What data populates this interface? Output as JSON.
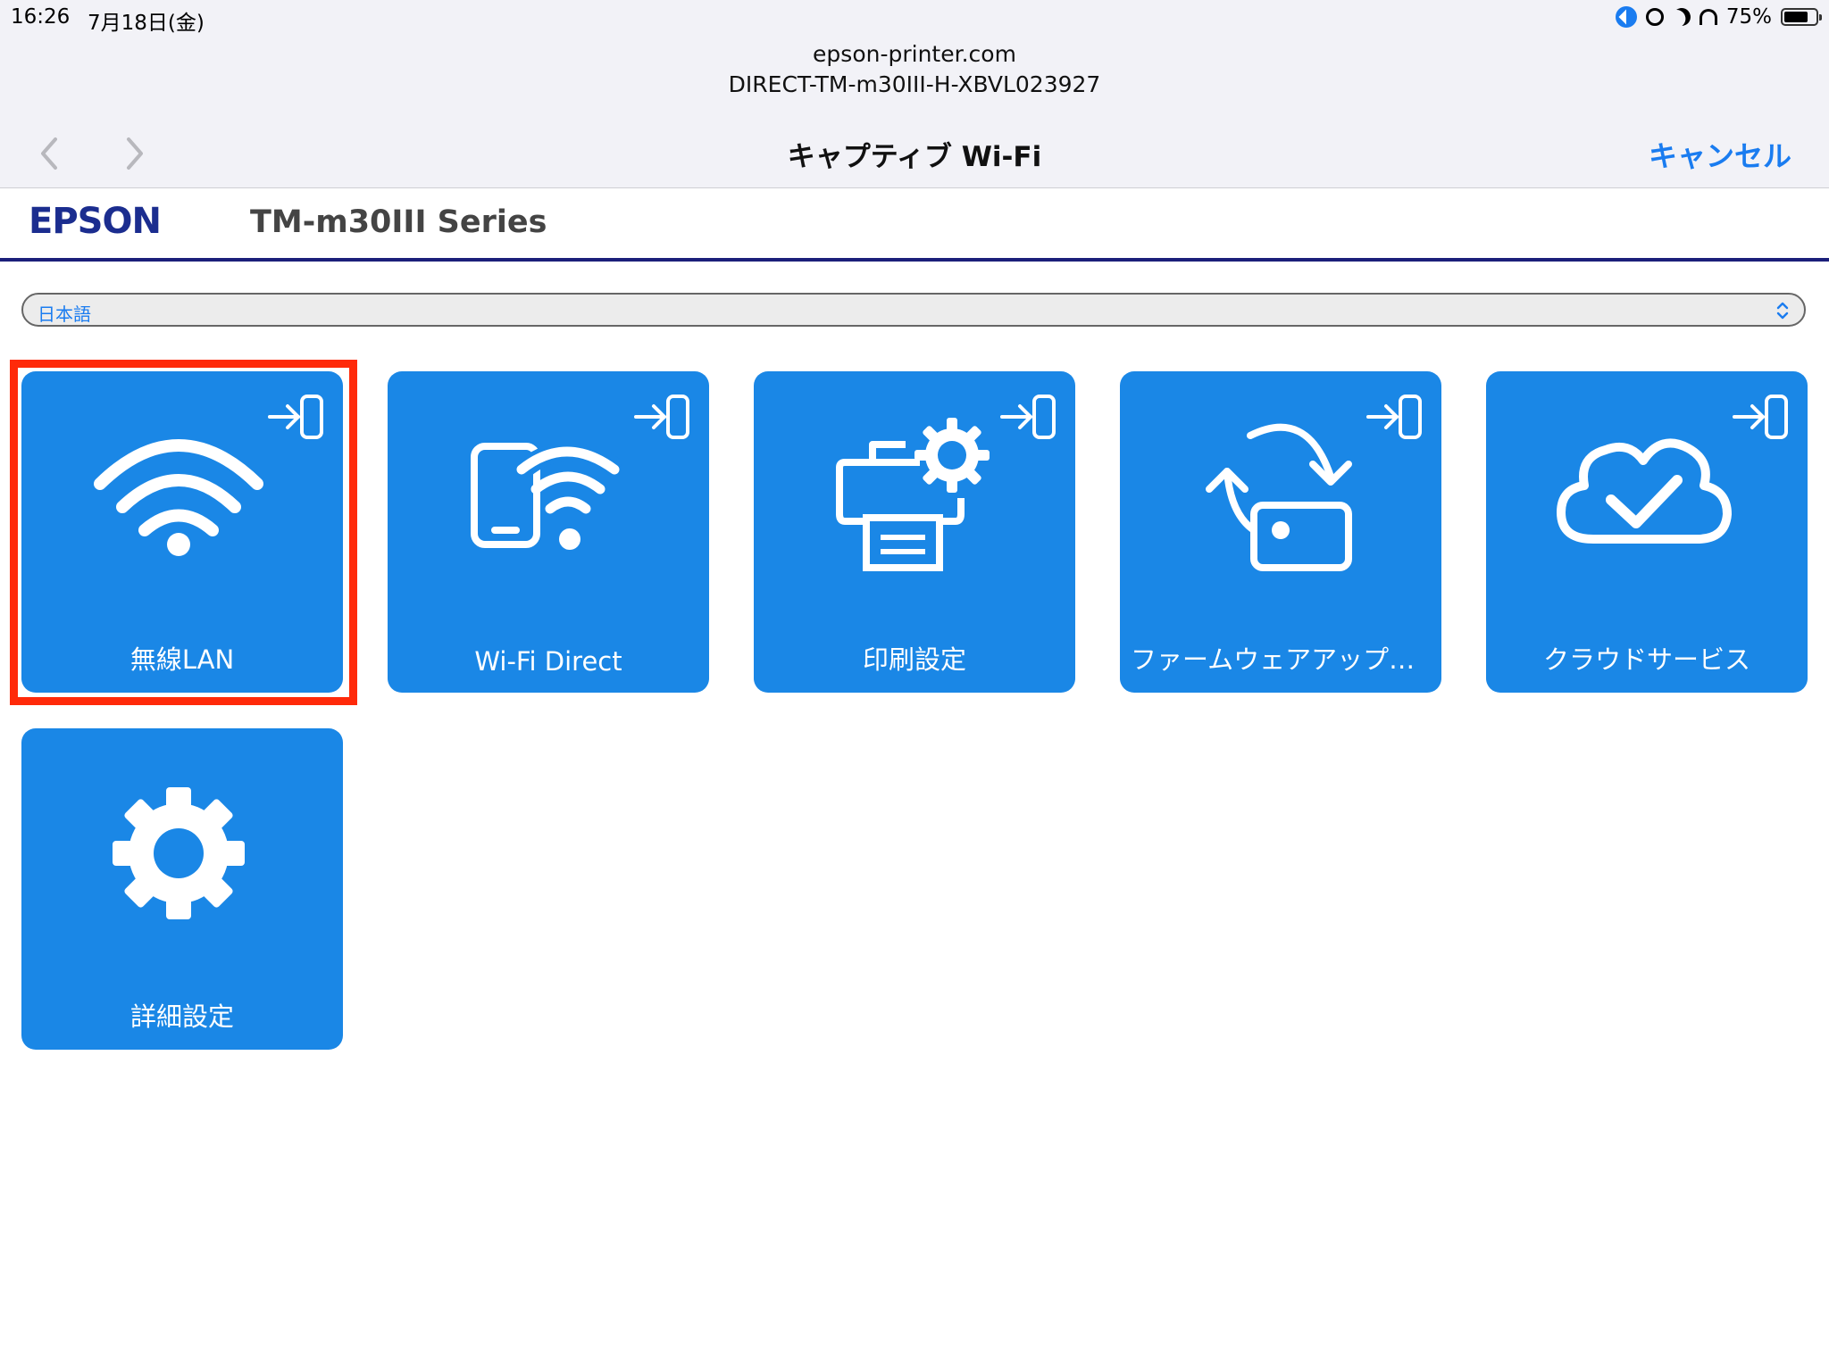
{
  "status_bar": {
    "time": "16:26",
    "date": "7月18日(金)",
    "battery": "75%",
    "battery_level": 0.75
  },
  "captive": {
    "domain": "epson-printer.com",
    "ssid": "DIRECT-TM-m30III-H-XBVL023927",
    "title": "キャプティブ Wi-Fi",
    "cancel_label": "キャンセル"
  },
  "epson": {
    "logo": "EPSON",
    "model": "TM-m30III Series"
  },
  "language_select": {
    "value": "日本語"
  },
  "tiles": [
    {
      "label": "無線LAN",
      "icon": "wifi-icon"
    },
    {
      "label": "Wi-Fi Direct",
      "icon": "wifi-direct-icon"
    },
    {
      "label": "印刷設定",
      "icon": "printer-settings-icon"
    },
    {
      "label": "ファームウェアアップデート",
      "icon": "firmware-update-icon"
    },
    {
      "label": "クラウドサービス",
      "icon": "cloud-check-icon"
    },
    {
      "label": "詳細設定",
      "icon": "gear-icon"
    }
  ],
  "colors": {
    "tile": "#1a87e6",
    "accent": "#1a7cf0",
    "highlight": "#ff2a0a",
    "epson_blue": "#1b2d8f"
  }
}
